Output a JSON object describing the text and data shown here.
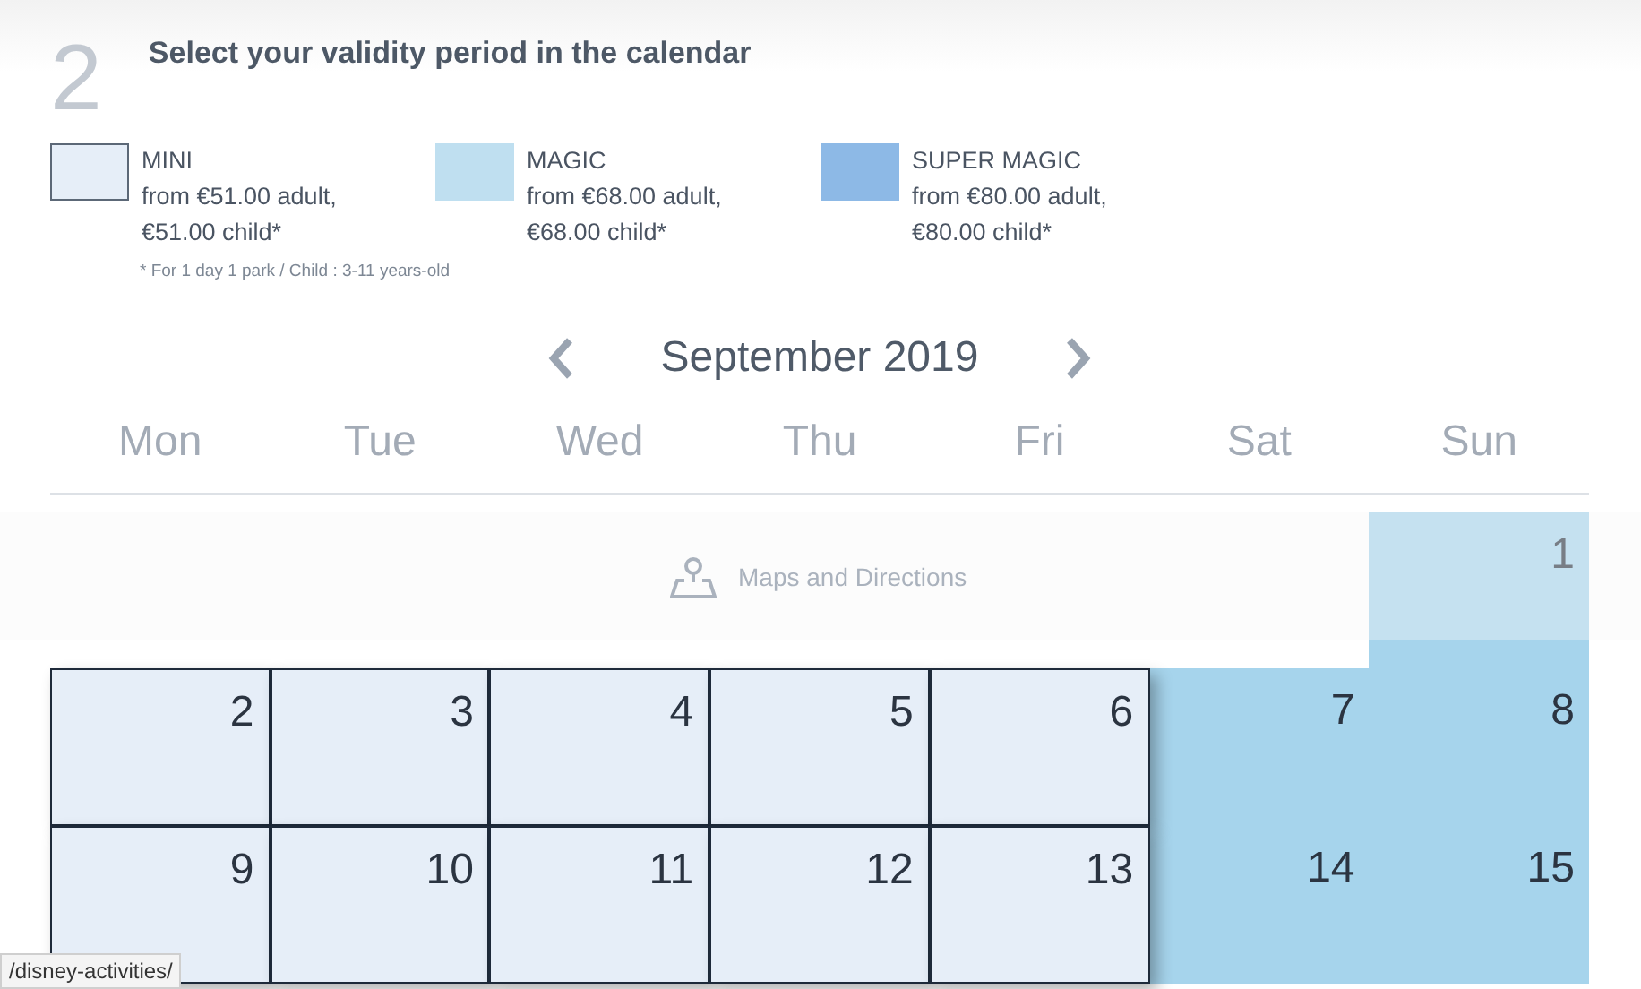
{
  "maps_link": "Maps and Directions",
  "step": "2",
  "title": "Select your validity period in the calendar",
  "legend": [
    {
      "name": "MINI",
      "adult": "from €51.00 adult,",
      "child": "€51.00 child*",
      "color": "#e6eef8",
      "outlined": true
    },
    {
      "name": "MAGIC",
      "adult": "from €68.00 adult,",
      "child": "€68.00 child*",
      "color": "#bfdff0",
      "outlined": false
    },
    {
      "name": "SUPER MAGIC",
      "adult": "from €80.00 adult,",
      "child": "€80.00 child*",
      "color": "#8db9e6",
      "outlined": false
    }
  ],
  "footnote": "* For 1 day 1 park / Child : 3-11 years-old",
  "calendar": {
    "month": "September 2019",
    "weekdays": [
      "Mon",
      "Tue",
      "Wed",
      "Thu",
      "Fri",
      "Sat",
      "Sun"
    ],
    "weeks": [
      [
        {
          "kind": "blank"
        },
        {
          "kind": "blank"
        },
        {
          "kind": "blank"
        },
        {
          "kind": "blank"
        },
        {
          "kind": "blank"
        },
        {
          "kind": "blank"
        },
        {
          "kind": "day",
          "day": "1",
          "color": "#a6d4ec",
          "selected": false
        }
      ],
      [
        {
          "kind": "day",
          "day": "2",
          "color": "#e6eef8",
          "selected": true
        },
        {
          "kind": "day",
          "day": "3",
          "color": "#e6eef8",
          "selected": true
        },
        {
          "kind": "day",
          "day": "4",
          "color": "#e6eef8",
          "selected": true
        },
        {
          "kind": "day",
          "day": "5",
          "color": "#e6eef8",
          "selected": true
        },
        {
          "kind": "day",
          "day": "6",
          "color": "#e6eef8",
          "selected": true
        },
        {
          "kind": "day",
          "day": "7",
          "color": "#a6d4ec",
          "selected": false
        },
        {
          "kind": "day",
          "day": "8",
          "color": "#a6d4ec",
          "selected": false
        }
      ],
      [
        {
          "kind": "day",
          "day": "9",
          "color": "#e6eef8",
          "selected": true
        },
        {
          "kind": "day",
          "day": "10",
          "color": "#e6eef8",
          "selected": true
        },
        {
          "kind": "day",
          "day": "11",
          "color": "#e6eef8",
          "selected": true
        },
        {
          "kind": "day",
          "day": "12",
          "color": "#e6eef8",
          "selected": true
        },
        {
          "kind": "day",
          "day": "13",
          "color": "#e6eef8",
          "selected": true
        },
        {
          "kind": "day",
          "day": "14",
          "color": "#a6d4ec",
          "selected": false
        },
        {
          "kind": "day",
          "day": "15",
          "color": "#a6d4ec",
          "selected": false
        }
      ]
    ]
  },
  "status_url": "/disney-activities/"
}
